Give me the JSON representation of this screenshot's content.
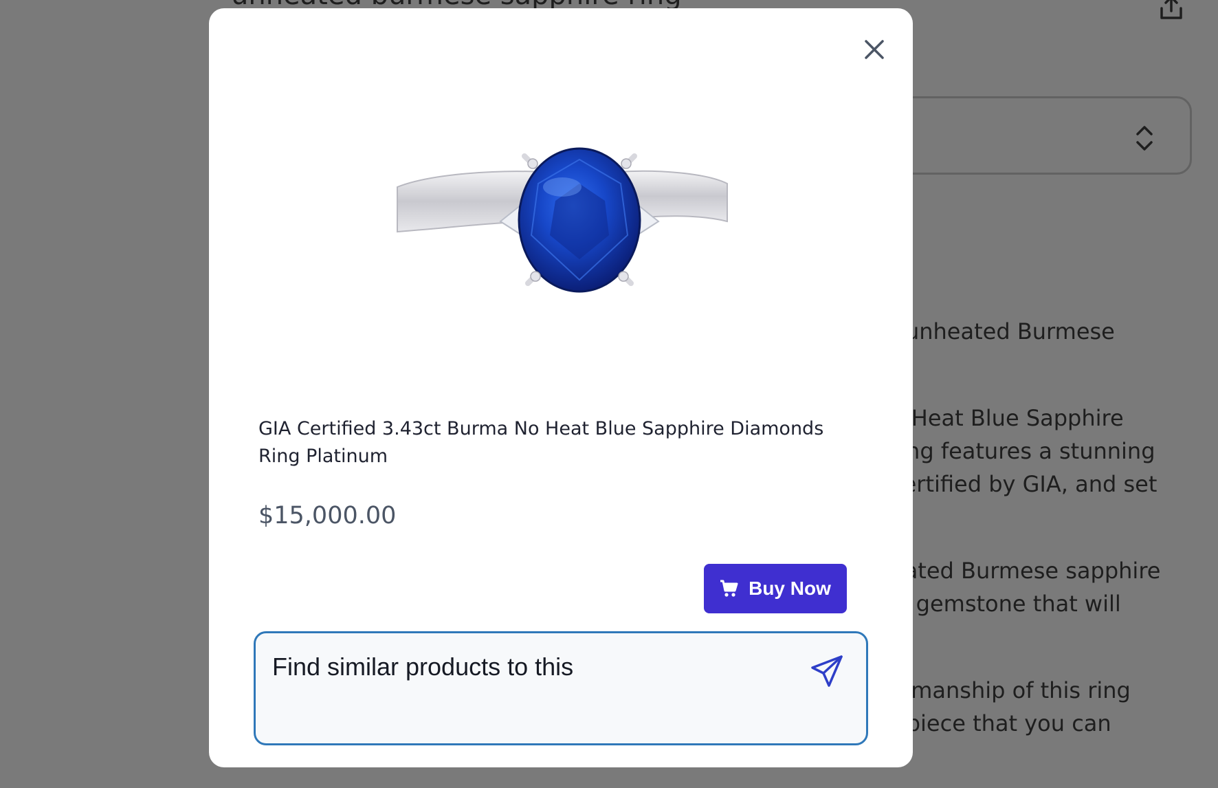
{
  "background": {
    "query_title": "unheated burmese sapphire ring",
    "icons": {
      "share": "share-upload-icon",
      "select": "chevron-updown-icon"
    },
    "text_lines": [
      ": unheated Burmese",
      "o Heat Blue Sapphire",
      " ring features a stunning",
      "certified by GIA, and set",
      "eated Burmese sapphire",
      "ic gemstone that will",
      "tsmanship of this ring",
      "t piece that you can"
    ]
  },
  "modal": {
    "close_icon": "close-icon",
    "product": {
      "image_alt": "blue-sapphire-ring-image",
      "title": "GIA Certified 3.43ct Burma No Heat Blue Sapphire Diamonds Ring Platinum",
      "price": "$15,000.00"
    },
    "buy_button": {
      "label": "Buy Now",
      "icon": "cart-icon",
      "color": "#3f2fd0"
    },
    "chat": {
      "value": "Find similar products to this",
      "send_icon": "send-icon",
      "border_color": "#2f78b9"
    }
  }
}
